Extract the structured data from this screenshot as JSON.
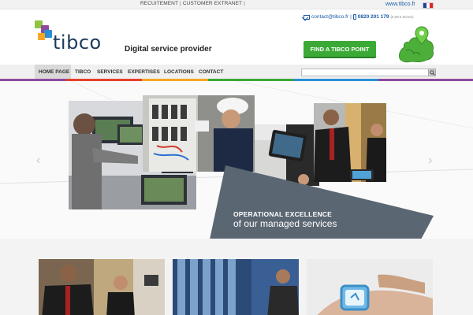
{
  "topbar": {
    "links": [
      "RECUITEMENT",
      "CUSTOMER EXTRANET"
    ],
    "site_link": "www.tibco.fr",
    "flag_colors": [
      "#1f3f99",
      "#ffffff",
      "#e1232c"
    ]
  },
  "header": {
    "logo_text": "tibco",
    "tagline": "Digital service provider",
    "email": "contact@tibco.fr",
    "phone": "0820 201 179",
    "phone_price": "(0,09 € ttc/mn)",
    "find_button": "FIND A TIBCO POINT",
    "icons": [
      "envelope-icon",
      "phone-icon",
      "europe-map-icon",
      "search-icon"
    ]
  },
  "nav": {
    "items": [
      "HOME PAGE",
      "TIBCO",
      "SERVICES",
      "EXPERTISES",
      "LOCATIONS",
      "CONTACT"
    ],
    "active_index": 0,
    "search_placeholder": ""
  },
  "hero": {
    "slogan_line1": "OPERATIONAL EXCELLENCE",
    "slogan_line2": "of our managed services"
  },
  "colors": {
    "brand_blue": "#1b3a5c",
    "link_blue": "#1a5ba8",
    "green_button": "#3ba935",
    "slate": "#5b6673"
  }
}
